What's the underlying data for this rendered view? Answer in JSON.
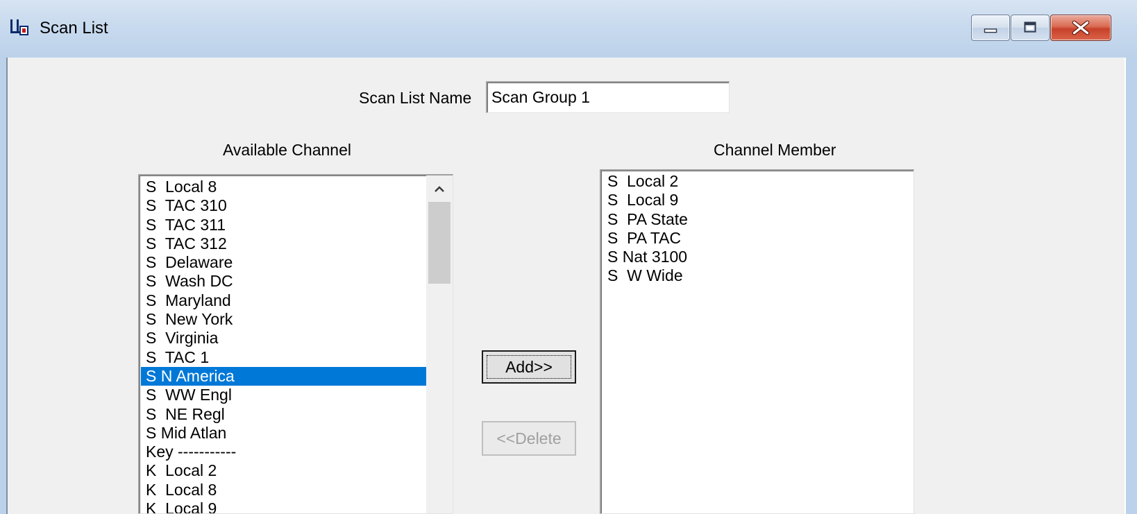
{
  "window": {
    "title": "Scan List"
  },
  "form": {
    "scan_list_name_label": "Scan List Name",
    "scan_list_name_value": "Scan Group 1",
    "available_channel_label": "Available Channel",
    "channel_member_label": "Channel Member",
    "add_button": "Add>>",
    "delete_button": "<<Delete",
    "delete_enabled": false
  },
  "available_channels": [
    {
      "label": "S  Local 8",
      "selected": false
    },
    {
      "label": "S  TAC 310",
      "selected": false
    },
    {
      "label": "S  TAC 311",
      "selected": false
    },
    {
      "label": "S  TAC 312",
      "selected": false
    },
    {
      "label": "S  Delaware",
      "selected": false
    },
    {
      "label": "S  Wash DC",
      "selected": false
    },
    {
      "label": "S  Maryland",
      "selected": false
    },
    {
      "label": "S  New York",
      "selected": false
    },
    {
      "label": "S  Virginia",
      "selected": false
    },
    {
      "label": "S  TAC 1",
      "selected": false
    },
    {
      "label": "S N America",
      "selected": true
    },
    {
      "label": "S  WW Engl",
      "selected": false
    },
    {
      "label": "S  NE Regl",
      "selected": false
    },
    {
      "label": "S Mid Atlan",
      "selected": false
    },
    {
      "label": "Key -----------",
      "selected": false
    },
    {
      "label": "K  Local 2",
      "selected": false
    },
    {
      "label": "K  Local 8",
      "selected": false
    },
    {
      "label": "K  Local 9",
      "selected": false
    }
  ],
  "channel_members": [
    "S  Local 2",
    "S  Local 9",
    "S  PA State",
    "S  PA TAC",
    "S Nat 3100",
    "S  W Wide"
  ],
  "colors": {
    "selection": "#0078d7",
    "titlebar": "#c8daee",
    "close_button": "#c8412a",
    "window_bg": "#f0f0f0"
  },
  "icons": {
    "app": "scan-list-app-icon",
    "minimize": "minimize-icon",
    "maximize": "maximize-icon",
    "close": "close-icon",
    "scroll_up": "chevron-up-icon"
  }
}
